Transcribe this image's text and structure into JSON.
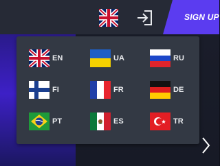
{
  "header": {
    "current_language_flag": "uk-flag-icon",
    "login_icon": "login-arrow-icon",
    "signup_label": "SIGN UP",
    "signup_color": "#5b3cf0"
  },
  "language_menu": {
    "items": [
      {
        "code": "EN",
        "flag": "uk-flag-icon"
      },
      {
        "code": "UA",
        "flag": "ukraine-flag-icon"
      },
      {
        "code": "RU",
        "flag": "russia-flag-icon"
      },
      {
        "code": "FI",
        "flag": "finland-flag-icon"
      },
      {
        "code": "FR",
        "flag": "france-flag-icon"
      },
      {
        "code": "DE",
        "flag": "germany-flag-icon"
      },
      {
        "code": "PT",
        "flag": "brazil-flag-icon"
      },
      {
        "code": "ES",
        "flag": "mexico-flag-icon"
      },
      {
        "code": "TR",
        "flag": "turkey-flag-icon"
      }
    ]
  },
  "carousel": {
    "next_icon": "chevron-right-icon"
  }
}
